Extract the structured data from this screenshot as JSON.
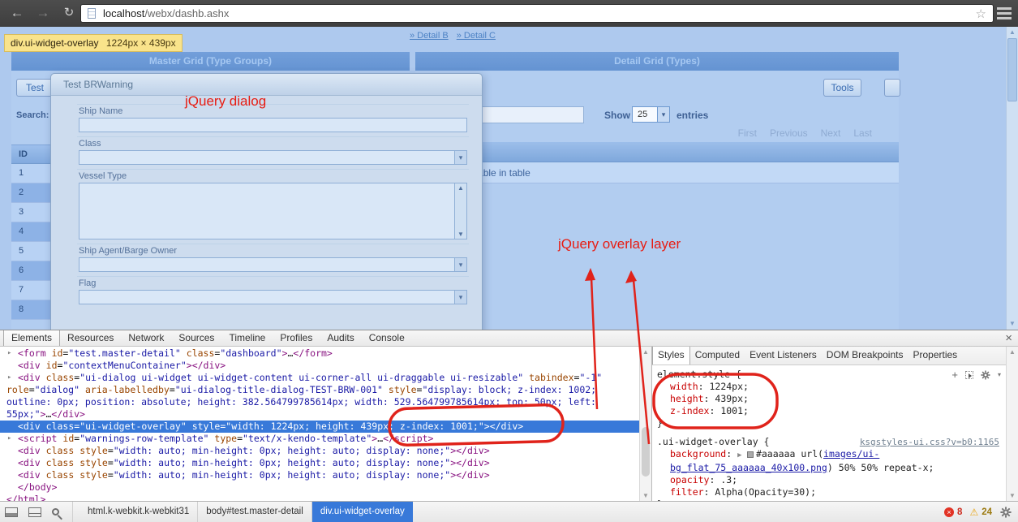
{
  "browser": {
    "url_domain": "localhost",
    "url_path": "/webx/dashb.ashx"
  },
  "icons": {
    "back": "←",
    "forward": "→",
    "reload": "↻",
    "bookmark_star": "☆",
    "close": "×",
    "expand_right": "▸",
    "expand_right_small": "▶ ",
    "dropdown": "▾",
    "scroll_up": "▲",
    "scroll_down": "▼",
    "error_x": "×",
    "warning": "⚠",
    "plus": "+"
  },
  "inspect_tooltip": {
    "selector": "div.ui-widget-overlay",
    "dimensions": "1224px × 439px"
  },
  "page": {
    "links": [
      {
        "label": "» Detail B"
      },
      {
        "label": "» Detail C"
      }
    ],
    "master_grid": {
      "title": "Master Grid (Type Groups)",
      "toolbar_button": "Test",
      "search_label": "Search:",
      "col_id": "ID",
      "row_numbers": [
        "1",
        "2",
        "3",
        "4",
        "5",
        "6",
        "7",
        "8"
      ]
    },
    "detail_grid": {
      "title": "Detail Grid (Types)",
      "tools_button": "Tools",
      "show_label": "Show",
      "page_size": "25",
      "entries_label": "entries",
      "pager": [
        "First",
        "Previous",
        "Next",
        "Last"
      ],
      "empty_message": "No data available in table"
    },
    "dialog": {
      "title": "Test BRWarning",
      "fields": [
        {
          "label": "Ship Name",
          "control": "text"
        },
        {
          "label": "Class",
          "control": "select"
        },
        {
          "label": "Vessel Type",
          "control": "listbox"
        },
        {
          "label": "Ship Agent/Barge Owner",
          "control": "select"
        },
        {
          "label": "Flag",
          "control": "select"
        }
      ]
    },
    "annotations": {
      "dialog_callout": "jQuery dialog",
      "overlay_callout": "jQuery overlay layer",
      "annotation_color": "#e81c12"
    }
  },
  "devtools": {
    "tabs": [
      "Elements",
      "Resources",
      "Network",
      "Sources",
      "Timeline",
      "Profiles",
      "Audits",
      "Console"
    ],
    "active_tab": "Elements",
    "selection_color": "#3879d9",
    "dom_lines": [
      {
        "ind": 1,
        "arrow": true,
        "tok": [
          [
            "t",
            "<form"
          ],
          [
            "p",
            " "
          ],
          [
            "a",
            "id"
          ],
          [
            "p",
            "="
          ],
          [
            "v",
            "\"test.master-detail\""
          ],
          [
            "p",
            " "
          ],
          [
            "a",
            "class"
          ],
          [
            "p",
            "="
          ],
          [
            "v",
            "\"dashboard\""
          ],
          [
            "t",
            ">"
          ],
          [
            "e",
            "…"
          ],
          [
            "t",
            "</form>"
          ]
        ]
      },
      {
        "ind": 1,
        "tok": [
          [
            "t",
            "<div"
          ],
          [
            "p",
            " "
          ],
          [
            "a",
            "id"
          ],
          [
            "p",
            "="
          ],
          [
            "v",
            "\"contextMenuContainer\""
          ],
          [
            "t",
            "></div>"
          ]
        ]
      },
      {
        "ind": 1,
        "arrow": true,
        "tok": [
          [
            "t",
            "<div"
          ],
          [
            "p",
            " "
          ],
          [
            "a",
            "class"
          ],
          [
            "p",
            "="
          ],
          [
            "v",
            "\"ui-dialog ui-widget ui-widget-content ui-corner-all ui-draggable ui-resizable\""
          ],
          [
            "p",
            " "
          ],
          [
            "a",
            "tabindex"
          ],
          [
            "p",
            "="
          ],
          [
            "v",
            "\"-1\""
          ]
        ]
      },
      {
        "wrap": true,
        "tok": [
          [
            "a",
            "role"
          ],
          [
            "p",
            "="
          ],
          [
            "v",
            "\"dialog\""
          ],
          [
            "p",
            " "
          ],
          [
            "a",
            "aria-labelledby"
          ],
          [
            "p",
            "="
          ],
          [
            "v",
            "\"ui-dialog-title-dialog-TEST-BRW-001\""
          ],
          [
            "p",
            " "
          ],
          [
            "a",
            "style"
          ],
          [
            "p",
            "="
          ],
          [
            "v",
            "\"display: block; z-index: 1002;"
          ]
        ]
      },
      {
        "wrap": true,
        "tok": [
          [
            "v",
            "outline: 0px; position: absolute; height: 382.564799785614px; width: 529.564799785614px; top: 50px; left:"
          ]
        ]
      },
      {
        "wrap": true,
        "tok": [
          [
            "v",
            "55px;\""
          ],
          [
            "t",
            ">"
          ],
          [
            "e",
            "…"
          ],
          [
            "t",
            "</div>"
          ]
        ]
      },
      {
        "ind": 1,
        "sel": true,
        "tok": [
          [
            "t",
            "<div"
          ],
          [
            "p",
            " "
          ],
          [
            "a",
            "class"
          ],
          [
            "p",
            "="
          ],
          [
            "v",
            "\"ui-widget-overlay\""
          ],
          [
            "p",
            " "
          ],
          [
            "a",
            "style"
          ],
          [
            "p",
            "="
          ],
          [
            "v",
            "\"width: 1224px; height: 439px; z-index: 1001;\""
          ],
          [
            "t",
            "></div>"
          ]
        ]
      },
      {
        "ind": 1,
        "arrow": true,
        "tok": [
          [
            "t",
            "<script"
          ],
          [
            "p",
            " "
          ],
          [
            "a",
            "id"
          ],
          [
            "p",
            "="
          ],
          [
            "v",
            "\"warnings-row-template\""
          ],
          [
            "p",
            " "
          ],
          [
            "a",
            "type"
          ],
          [
            "p",
            "="
          ],
          [
            "v",
            "\"text/x-kendo-template\""
          ],
          [
            "t",
            ">"
          ],
          [
            "e",
            "…"
          ],
          [
            "t",
            "</script>"
          ]
        ]
      },
      {
        "ind": 1,
        "tok": [
          [
            "t",
            "<div"
          ],
          [
            "p",
            " "
          ],
          [
            "a",
            "class"
          ],
          [
            "p",
            " "
          ],
          [
            "a",
            "style"
          ],
          [
            "p",
            "="
          ],
          [
            "v",
            "\"width: auto; min-height: 0px; height: auto; display: none;\""
          ],
          [
            "t",
            "></div>"
          ]
        ]
      },
      {
        "ind": 1,
        "tok": [
          [
            "t",
            "<div"
          ],
          [
            "p",
            " "
          ],
          [
            "a",
            "class"
          ],
          [
            "p",
            " "
          ],
          [
            "a",
            "style"
          ],
          [
            "p",
            "="
          ],
          [
            "v",
            "\"width: auto; min-height: 0px; height: auto; display: none;\""
          ],
          [
            "t",
            "></div>"
          ]
        ]
      },
      {
        "ind": 1,
        "tok": [
          [
            "t",
            "<div"
          ],
          [
            "p",
            " "
          ],
          [
            "a",
            "class"
          ],
          [
            "p",
            " "
          ],
          [
            "a",
            "style"
          ],
          [
            "p",
            "="
          ],
          [
            "v",
            "\"width: auto; min-height: 0px; height: auto; display: none;\""
          ],
          [
            "t",
            "></div>"
          ]
        ]
      },
      {
        "ind": 1,
        "tok": [
          [
            "t",
            "</body>"
          ]
        ]
      },
      {
        "ind": 0,
        "tok": [
          [
            "t",
            "</html>"
          ]
        ]
      }
    ],
    "styles_panel": {
      "tabs": [
        "Styles",
        "Computed",
        "Event Listeners",
        "DOM Breakpoints",
        "Properties"
      ],
      "active_tab": "Styles",
      "rules": [
        {
          "selector": "element.style",
          "source": "",
          "props": [
            {
              "n": "width",
              "v": "1224px"
            },
            {
              "n": "height",
              "v": "439px"
            },
            {
              "n": "z-index",
              "v": "1001"
            }
          ]
        },
        {
          "selector": ".ui-widget-overlay",
          "source": "ksgstyles-ui.css?v=b0:1165",
          "props": [
            {
              "n": "background",
              "v_pre": "#aaaaaa url(",
              "link_lines": [
                "images/ui-",
                "bg_flat_75_aaaaaa_40x100.png"
              ],
              "v_post": ") 50% 50% repeat-x",
              "swatch": "#aaaaaa",
              "expand": true
            },
            {
              "n": "opacity",
              "v": ".3"
            },
            {
              "n": "filter",
              "v": "Alpha(Opacity=30)"
            }
          ]
        }
      ]
    },
    "statusbar": {
      "breadcrumbs": [
        "html.k-webkit.k-webkit31",
        "body#test.master-detail",
        "div.ui-widget-overlay"
      ],
      "selected_crumb": "div.ui-widget-overlay",
      "error_count": "8",
      "warning_count": "24"
    }
  }
}
